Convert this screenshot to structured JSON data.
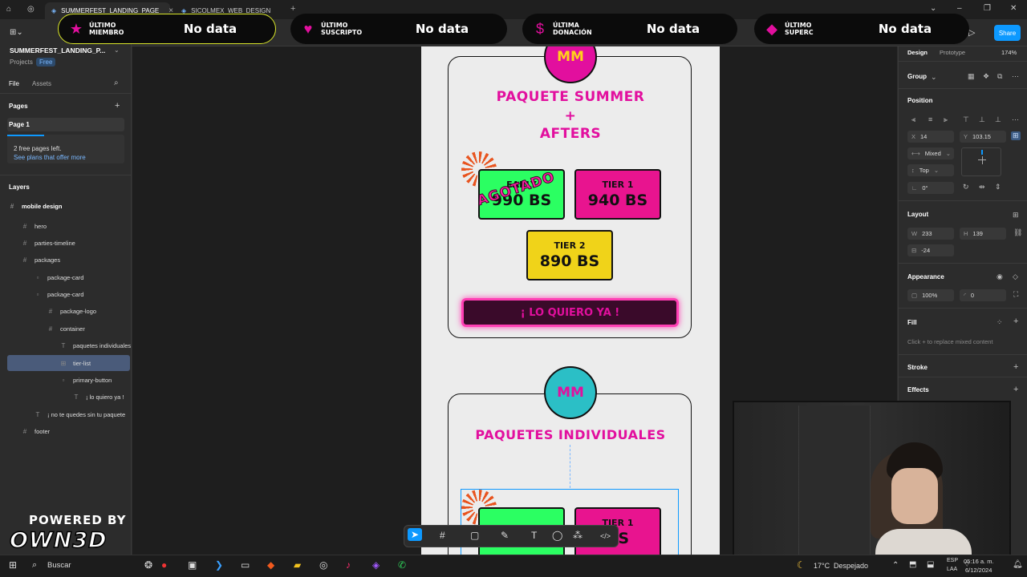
{
  "browser": {
    "tabs": [
      {
        "label": "SUMMERFEST_LANDING_PAGE",
        "active": true
      },
      {
        "label": "SICOLMEX_WEB_DESIGN",
        "active": false
      }
    ],
    "new_tab": "+"
  },
  "alerts": [
    {
      "icon": "star-icon",
      "label_line1": "ÚLTIMO",
      "label_line2": "MIEMBRO",
      "value": "No data"
    },
    {
      "icon": "heart-icon",
      "label_line1": "ÚLTIMO",
      "label_line2": "SUSCRIPTO",
      "value": "No data"
    },
    {
      "icon": "dollar-icon",
      "label_line1": "ÚLTIMA",
      "label_line2": "DONACIÓN",
      "value": "No data"
    },
    {
      "icon": "diamond-icon",
      "label_line1": "ÚLTIMO",
      "label_line2": "SUPERC",
      "value": "No data"
    }
  ],
  "figma": {
    "share_label": "Share",
    "file_name": "SUMMERFEST_LANDING_P...",
    "projects_label": "Projects",
    "plan_badge": "Free",
    "tabs": {
      "file": "File",
      "assets": "Assets"
    },
    "pages_header": "Pages",
    "page_1": "Page 1",
    "free_pages_note": "2 free pages left.",
    "plans_link": "See plans that offer more",
    "layers_header": "Layers",
    "layers": [
      {
        "name": "mobile design"
      },
      {
        "name": "hero"
      },
      {
        "name": "parties-timeline"
      },
      {
        "name": "packages"
      },
      {
        "name": "package-card"
      },
      {
        "name": "package-card"
      },
      {
        "name": "package-logo"
      },
      {
        "name": "container"
      },
      {
        "name": "paquetes individuales"
      },
      {
        "name": "tier-list"
      },
      {
        "name": "primary-button"
      },
      {
        "name": "¡ lo quiero ya !"
      },
      {
        "name": "¡ no te quedes sin tu paquete"
      },
      {
        "name": "footer"
      }
    ]
  },
  "design_panel": {
    "tabs": {
      "design": "Design",
      "prototype": "Prototype"
    },
    "zoom": "174%",
    "selection_type": "Group",
    "position_header": "Position",
    "x_label": "X",
    "x_value": "14",
    "y_label": "Y",
    "y_value": "103.15",
    "constraint_h": "Mixed",
    "constraint_v": "Top",
    "rotation": "0°",
    "layout_header": "Layout",
    "w_label": "W",
    "w_value": "233",
    "h_label": "H",
    "h_value": "139",
    "gap_value": "-24",
    "appearance_header": "Appearance",
    "opacity": "100%",
    "radius": "0",
    "fill_header": "Fill",
    "fill_hint": "Click + to replace mixed content",
    "stroke_header": "Stroke",
    "effects_header": "Effects"
  },
  "canvas": {
    "card1": {
      "logo_text": "MM",
      "title_line1": "PAQUETE SUMMER",
      "title_line2": "+",
      "title_line3": "AFTERS",
      "tiers": [
        {
          "name": "EARLY",
          "price": "990 BS",
          "color": "#2bff62"
        },
        {
          "name": "TIER 1",
          "price": "940 BS",
          "color": "#e8148f"
        },
        {
          "name": "TIER 2",
          "price": "890 BS",
          "color": "#f0d319"
        }
      ],
      "sold_out": "AGOTADO",
      "button": "¡ LO QUIERO YA !"
    },
    "card2": {
      "logo_text": "MM",
      "title": "PAQUETES INDIVIDUALES",
      "tier1_partial": "TIER 1",
      "price_partial": "BS"
    }
  },
  "overlay": {
    "powered_by": "POWERED BY",
    "brand": "OWN3D"
  },
  "taskbar": {
    "search": "Buscar",
    "weather_temp": "17°C",
    "weather_desc": "Despejado",
    "lang_top": "ESP",
    "lang_bottom": "LAA",
    "time": "05:16 a. m.",
    "date": "6/12/2024"
  },
  "colors": {
    "accent": "#0d99ff",
    "magenta": "#e20f9e",
    "teal": "#2bbfc6"
  }
}
